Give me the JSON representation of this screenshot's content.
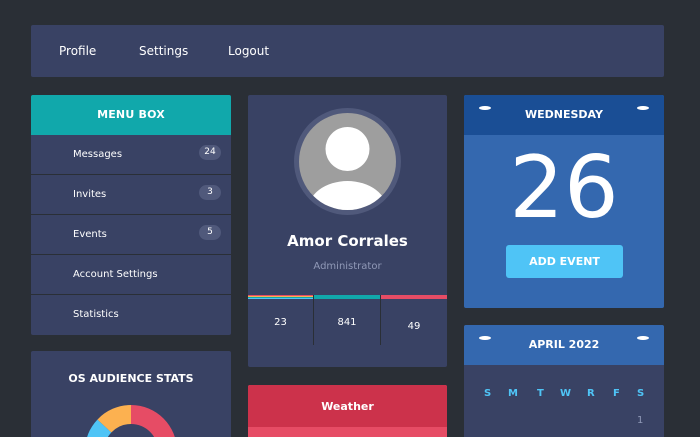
{
  "nav": {
    "items": [
      "Profile",
      "Settings",
      "Logout"
    ]
  },
  "menu_box": {
    "title": "MENU BOX",
    "items": [
      {
        "label": "Messages",
        "count": "24"
      },
      {
        "label": "Invites",
        "count": "3"
      },
      {
        "label": "Events",
        "count": "5"
      },
      {
        "label": "Account Settings"
      },
      {
        "label": "Statistics"
      }
    ]
  },
  "os_stats": {
    "title": "OS AUDIENCE STATS"
  },
  "profile": {
    "name": "Amor Corrales",
    "role": "Administrator",
    "stats": [
      {
        "value": "23",
        "color": "#e64c65"
      },
      {
        "value": "841",
        "color": "#11a8ab"
      },
      {
        "value": "49",
        "color": "#e64c65"
      }
    ]
  },
  "weather": {
    "title": "Weather"
  },
  "calendar": {
    "weekday": "WEDNESDAY",
    "day": "26",
    "add_event": "ADD EVENT"
  },
  "month": {
    "title": "APRIL 2022",
    "days_of_week": [
      "S",
      "M",
      "T",
      "W",
      "R",
      "F",
      "S"
    ],
    "first_day": "1"
  },
  "colors": {
    "background": "#2a2f36",
    "panel": "#394264",
    "teal": "#11a8ab",
    "red": "#e64c65",
    "blue": "#3468af",
    "light_blue": "#4fc4f6",
    "orange": "#fcb150"
  }
}
